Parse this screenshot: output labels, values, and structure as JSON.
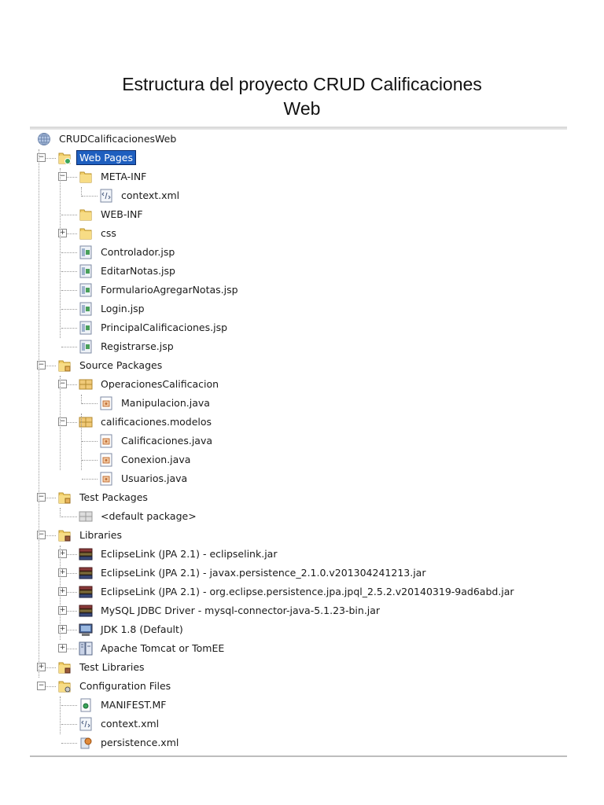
{
  "title_line1": "Estructura del proyecto CRUD Calificaciones",
  "title_line2": "Web",
  "tree": [
    {
      "label": "CRUDCalificacionesWeb",
      "level": 0,
      "icon": "globe-icon",
      "exp": ""
    },
    {
      "label": "Web Pages",
      "level": 1,
      "icon": "web-folder-icon",
      "exp": "-",
      "selected": true
    },
    {
      "label": "META-INF",
      "level": 2,
      "icon": "folder-icon",
      "exp": "-"
    },
    {
      "label": "context.xml",
      "level": 3,
      "icon": "xml-file-icon",
      "exp": ""
    },
    {
      "label": "WEB-INF",
      "level": 2,
      "icon": "folder-icon",
      "exp": ""
    },
    {
      "label": "css",
      "level": 2,
      "icon": "folder-icon",
      "exp": "+"
    },
    {
      "label": "Controlador.jsp",
      "level": 2,
      "icon": "jsp-file-icon",
      "exp": ""
    },
    {
      "label": "EditarNotas.jsp",
      "level": 2,
      "icon": "jsp-file-icon",
      "exp": ""
    },
    {
      "label": "FormularioAgregarNotas.jsp",
      "level": 2,
      "icon": "jsp-file-icon",
      "exp": ""
    },
    {
      "label": "Login.jsp",
      "level": 2,
      "icon": "jsp-file-icon",
      "exp": ""
    },
    {
      "label": "PrincipalCalificaciones.jsp",
      "level": 2,
      "icon": "jsp-file-icon",
      "exp": ""
    },
    {
      "label": "Registrarse.jsp",
      "level": 2,
      "icon": "jsp-file-icon",
      "exp": ""
    },
    {
      "label": "Source Packages",
      "level": 1,
      "icon": "source-folder-icon",
      "exp": "-"
    },
    {
      "label": "OperacionesCalificacion",
      "level": 2,
      "icon": "package-icon",
      "exp": "-"
    },
    {
      "label": "Manipulacion.java",
      "level": 3,
      "icon": "java-file-icon",
      "exp": ""
    },
    {
      "label": "calificaciones.modelos",
      "level": 2,
      "icon": "package-icon",
      "exp": "-"
    },
    {
      "label": "Calificaciones.java",
      "level": 3,
      "icon": "java-file-icon",
      "exp": ""
    },
    {
      "label": "Conexion.java",
      "level": 3,
      "icon": "java-file-icon",
      "exp": ""
    },
    {
      "label": "Usuarios.java",
      "level": 3,
      "icon": "java-file-icon",
      "exp": ""
    },
    {
      "label": "Test Packages",
      "level": 1,
      "icon": "source-folder-icon",
      "exp": "-"
    },
    {
      "label": "<default package>",
      "level": 2,
      "icon": "empty-package-icon",
      "exp": ""
    },
    {
      "label": "Libraries",
      "level": 1,
      "icon": "library-folder-icon",
      "exp": "-"
    },
    {
      "label": "EclipseLink (JPA 2.1) - eclipselink.jar",
      "level": 2,
      "icon": "jar-books-icon",
      "exp": "+"
    },
    {
      "label": "EclipseLink (JPA 2.1) - javax.persistence_2.1.0.v201304241213.jar",
      "level": 2,
      "icon": "jar-books-icon",
      "exp": "+"
    },
    {
      "label": "EclipseLink (JPA 2.1) - org.eclipse.persistence.jpa.jpql_2.5.2.v20140319-9ad6abd.jar",
      "level": 2,
      "icon": "jar-books-icon",
      "exp": "+"
    },
    {
      "label": "MySQL JDBC Driver - mysql-connector-java-5.1.23-bin.jar",
      "level": 2,
      "icon": "jar-books-icon",
      "exp": "+"
    },
    {
      "label": "JDK 1.8 (Default)",
      "level": 2,
      "icon": "jdk-monitor-icon",
      "exp": "+"
    },
    {
      "label": "Apache Tomcat or TomEE",
      "level": 2,
      "icon": "server-icon",
      "exp": "+"
    },
    {
      "label": "Test Libraries",
      "level": 1,
      "icon": "library-folder-icon",
      "exp": "+"
    },
    {
      "label": "Configuration Files",
      "level": 1,
      "icon": "config-folder-icon",
      "exp": "-"
    },
    {
      "label": "MANIFEST.MF",
      "level": 2,
      "icon": "manifest-file-icon",
      "exp": ""
    },
    {
      "label": "context.xml",
      "level": 2,
      "icon": "xml-file-icon",
      "exp": ""
    },
    {
      "label": "persistence.xml",
      "level": 2,
      "icon": "persistence-file-icon",
      "exp": ""
    }
  ]
}
